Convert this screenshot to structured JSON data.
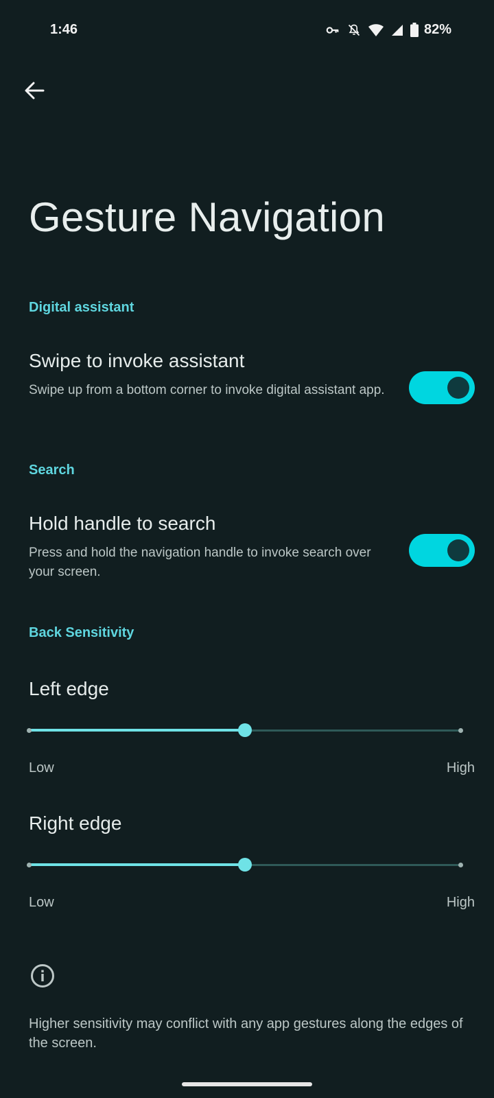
{
  "status_bar": {
    "time": "1:46",
    "battery_percent": "82%",
    "icons": [
      "vpn-key-icon",
      "mute-icon",
      "wifi-icon",
      "signal-icon",
      "battery-icon"
    ]
  },
  "header": {
    "back_icon": "arrow-back-icon",
    "title": "Gesture Navigation"
  },
  "sections": {
    "assistant": {
      "header": "Digital assistant",
      "title": "Swipe to invoke assistant",
      "summary": "Swipe up from a bottom corner to invoke digital assistant app.",
      "enabled": true
    },
    "search": {
      "header": "Search",
      "title": "Hold handle to search",
      "summary": "Press and hold the navigation handle to invoke search over your screen.",
      "enabled": true
    },
    "back_sensitivity": {
      "header": "Back Sensitivity",
      "left_edge": {
        "title": "Left edge",
        "value": 0.5,
        "low_label": "Low",
        "high_label": "High"
      },
      "right_edge": {
        "title": "Right edge",
        "value": 0.5,
        "low_label": "Low",
        "high_label": "High"
      }
    }
  },
  "footer": {
    "info_icon": "info-icon",
    "text": "Higher sensitivity may conflict with any app gestures along the edges of the screen."
  },
  "colors": {
    "background": "#111e20",
    "accent": "#5fd6df",
    "toggle_on": "#00d6e0",
    "slider_active": "#6fe2e6"
  }
}
